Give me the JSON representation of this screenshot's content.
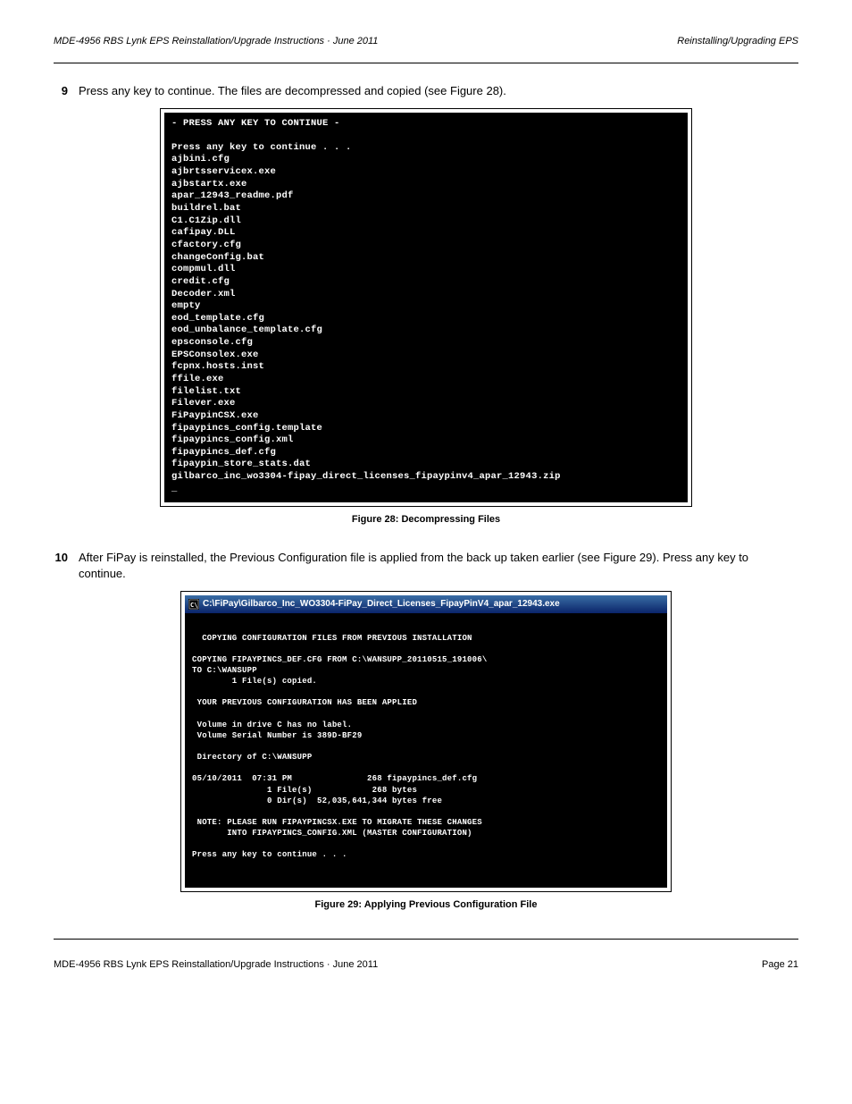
{
  "header": {
    "left": "MDE-4956 RBS Lynk EPS Reinstallation/Upgrade Instructions · June 2011",
    "right": "Reinstalling/Upgrading EPS"
  },
  "step9": {
    "num": "9",
    "text_prefix": "Press any key to continue. The files are decompressed and copied (see ",
    "link": "Figure 28",
    "text_suffix": ")."
  },
  "terminal1_lines": [
    "- PRESS ANY KEY TO CONTINUE -",
    "",
    "Press any key to continue . . .",
    "ajbini.cfg",
    "ajbrtsservicex.exe",
    "ajbstartx.exe",
    "apar_12943_readme.pdf",
    "buildrel.bat",
    "C1.C1Zip.dll",
    "cafipay.DLL",
    "cfactory.cfg",
    "changeConfig.bat",
    "compmul.dll",
    "credit.cfg",
    "Decoder.xml",
    "empty",
    "eod_template.cfg",
    "eod_unbalance_template.cfg",
    "epsconsole.cfg",
    "EPSConsolex.exe",
    "fcpnx.hosts.inst",
    "ffile.exe",
    "filelist.txt",
    "Filever.exe",
    "FiPaypinCSX.exe",
    "fipaypincs_config.template",
    "fipaypincs_config.xml",
    "fipaypincs_def.cfg",
    "fipaypin_store_stats.dat",
    "gilbarco_inc_wo3304-fipay_direct_licenses_fipaypinv4_apar_12943.zip",
    "_"
  ],
  "fig28_label": "Figure 28: Decompressing Files",
  "step10": {
    "num": "10",
    "text_part1": "After FiPay is reinstalled, the Previous Configuration file is applied from the back up taken earlier (see ",
    "link": "Figure 29",
    "text_part2": "). Press any key to continue."
  },
  "titlebar2": {
    "icon_glyph": "C:\\",
    "text": "C:\\FiPay\\Gilbarco_Inc_WO3304-FiPay_Direct_Licenses_FipayPinV4_apar_12943.exe"
  },
  "terminal2_lines": [
    "",
    "  COPYING CONFIGURATION FILES FROM PREVIOUS INSTALLATION",
    "",
    "COPYING FIPAYPINCS_DEF.CFG FROM C:\\WANSUPP_20110515_191006\\",
    "TO C:\\WANSUPP",
    "        1 File(s) copied.",
    "",
    " YOUR PREVIOUS CONFIGURATION HAS BEEN APPLIED",
    "",
    " Volume in drive C has no label.",
    " Volume Serial Number is 389D-BF29",
    "",
    " Directory of C:\\WANSUPP",
    "",
    "05/10/2011  07:31 PM               268 fipaypincs_def.cfg",
    "               1 File(s)            268 bytes",
    "               0 Dir(s)  52,035,641,344 bytes free",
    "",
    " NOTE: PLEASE RUN FIPAYPINCSX.EXE TO MIGRATE THESE CHANGES",
    "       INTO FIPAYPINCS_CONFIG.XML (MASTER CONFIGURATION)",
    "",
    "Press any key to continue . . ."
  ],
  "fig29_label": "Figure 29: Applying Previous Configuration File",
  "footer": {
    "left": "MDE-4956 RBS Lynk EPS Reinstallation/Upgrade Instructions · June 2011",
    "right": "Page 21"
  }
}
